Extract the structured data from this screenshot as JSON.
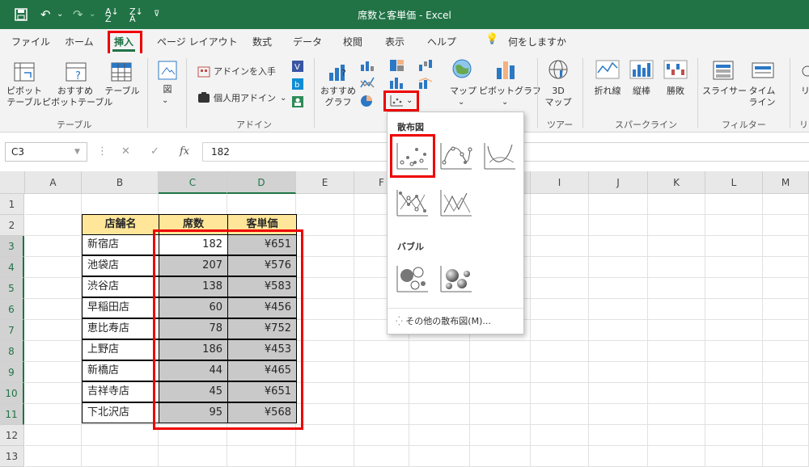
{
  "titlebar": {
    "title": "席数と客単価 - Excel",
    "qat": {
      "save_icon": "save-icon",
      "undo_icon": "undo-icon",
      "redo_icon": "redo-icon",
      "sort_asc_icon": "sort-asc-icon",
      "sort_desc_icon": "sort-desc-icon",
      "customize_icon": "customize-icon"
    }
  },
  "tabs": [
    "ファイル",
    "ホーム",
    "挿入",
    "ページ レイアウト",
    "数式",
    "データ",
    "校閲",
    "表示",
    "ヘルプ"
  ],
  "active_tab": "挿入",
  "tell_me": "何をしますか",
  "ribbon": {
    "table_group": {
      "label": "テーブル",
      "pivot": "ピボット\nテーブル",
      "recommended_pivot": "おすすめ\nピボットテーブル",
      "table": "テーブル"
    },
    "illustrations": {
      "label": "図"
    },
    "addins_group": {
      "label": "アドイン",
      "get_addins": "アドインを入手",
      "my_addins": "個人用アドイン"
    },
    "charts_group": {
      "recommended": "おすすめ\nグラフ",
      "map": "マップ",
      "pivot_chart": "ピボットグラフ"
    },
    "tours_group": {
      "label": "ツアー",
      "map3d": "3D\nマップ"
    },
    "sparklines_group": {
      "label": "スパークライン",
      "line": "折れ線",
      "column": "縦棒",
      "win_loss": "勝敗"
    },
    "filters_group": {
      "label": "フィルター",
      "slicer": "スライサー",
      "timeline": "タイム\nライン"
    },
    "links_group": {
      "label": "リン"
    }
  },
  "formula_bar": {
    "name_box": "C3",
    "fx": "fx",
    "value": "182"
  },
  "columns": [
    "A",
    "B",
    "C",
    "D",
    "E",
    "F",
    "G",
    "H",
    "I",
    "J",
    "K",
    "L",
    "M"
  ],
  "rows": [
    "1",
    "2",
    "3",
    "4",
    "5",
    "6",
    "7",
    "8",
    "9",
    "10",
    "11",
    "12",
    "13"
  ],
  "table": {
    "headers": [
      "店舗名",
      "席数",
      "客単価"
    ],
    "rows": [
      [
        "新宿店",
        "182",
        "¥651"
      ],
      [
        "池袋店",
        "207",
        "¥576"
      ],
      [
        "渋谷店",
        "138",
        "¥583"
      ],
      [
        "早稲田店",
        "60",
        "¥456"
      ],
      [
        "恵比寿店",
        "78",
        "¥752"
      ],
      [
        "上野店",
        "186",
        "¥453"
      ],
      [
        "新橋店",
        "44",
        "¥465"
      ],
      [
        "吉祥寺店",
        "45",
        "¥651"
      ],
      [
        "下北沢店",
        "95",
        "¥568"
      ]
    ]
  },
  "scatter_menu": {
    "scatter_heading": "散布図",
    "bubble_heading": "バブル",
    "more": "その他の散布図(M)...",
    "items": [
      "scatter-icon",
      "scatter-smooth-lines-markers-icon",
      "scatter-smooth-lines-icon",
      "scatter-straight-lines-markers-icon",
      "scatter-straight-lines-icon",
      "bubble-icon",
      "bubble-3d-icon"
    ]
  },
  "colors": {
    "excel_green": "#217346",
    "highlight_red": "#ee0000",
    "header_fill": "#ffe699",
    "selection_fill": "#c9c9c9"
  }
}
